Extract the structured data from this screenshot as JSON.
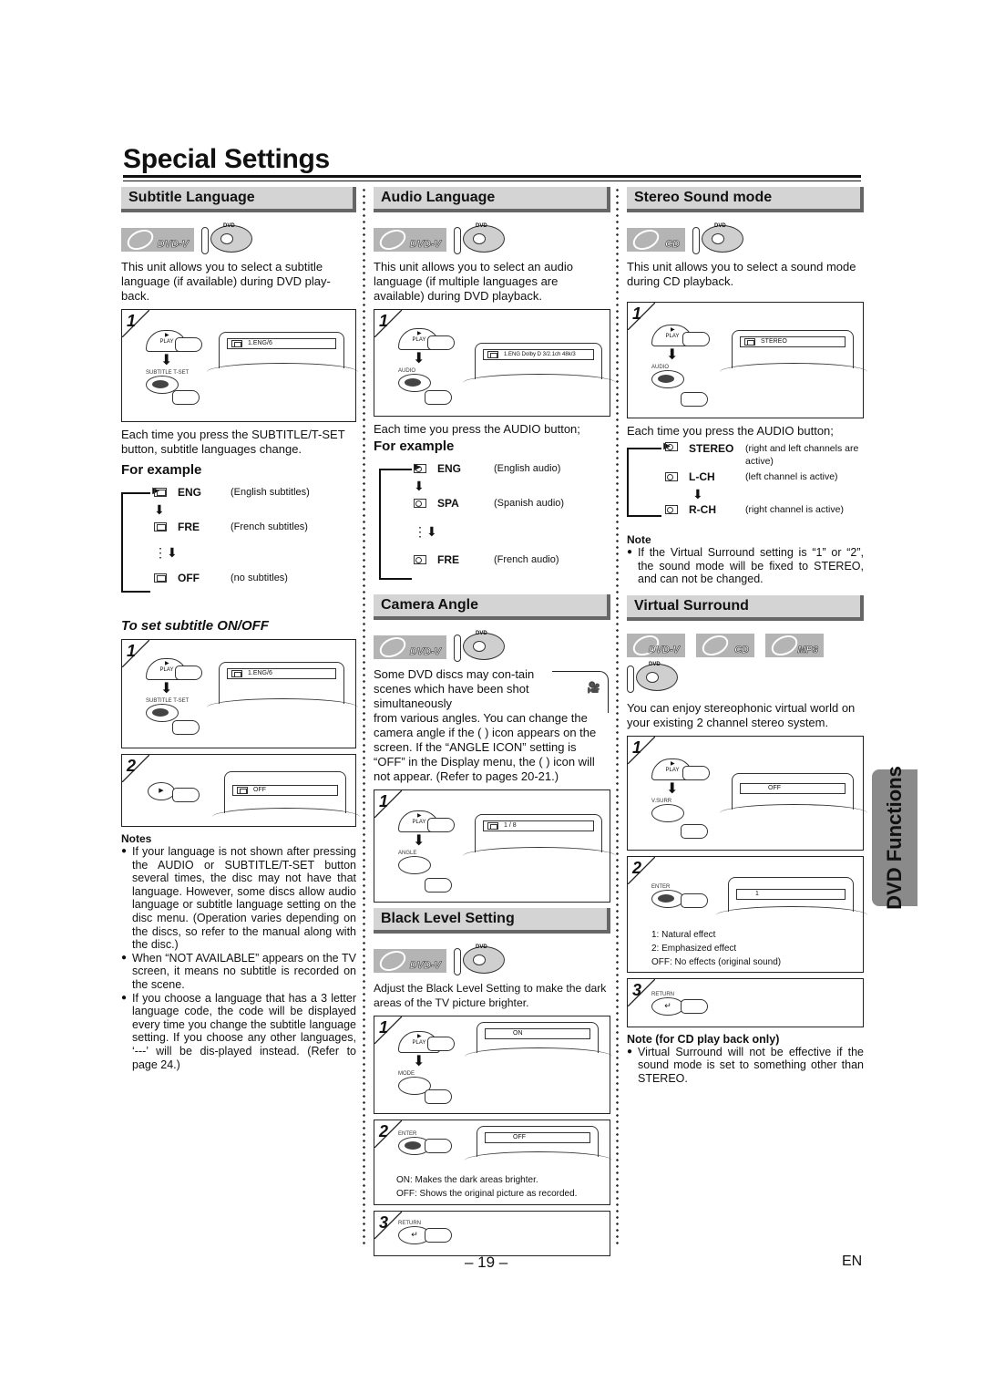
{
  "page": {
    "title": "Special Settings",
    "page_number": "– 19 –",
    "language_code": "EN",
    "side_tab": "DVD Functions"
  },
  "subtitle_language": {
    "heading": "Subtitle Language",
    "badges": [
      "DVD-V",
      "DVD"
    ],
    "intro": "This unit allows you to select a subtitle language (if available) during DVD play-back.",
    "step1": {
      "number": "1",
      "play_label": "PLAY",
      "button_label": "SUBTITLE T-SET",
      "osd": "1.ENG/6"
    },
    "after_step": "Each time you press the SUBTITLE/T-SET button, subtitle languages change.",
    "example_heading": "For example",
    "cycle": [
      {
        "code": "ENG",
        "desc": "(English subtitles)"
      },
      {
        "code": "FRE",
        "desc": "(French subtitles)"
      },
      {
        "code": "OFF",
        "desc": "(no subtitles)"
      }
    ],
    "onoff_heading": "To set subtitle ON/OFF",
    "onoff_step1": {
      "number": "1",
      "play_label": "PLAY",
      "button_label": "SUBTITLE T-SET",
      "osd": "1.ENG/6"
    },
    "onoff_step2": {
      "number": "2",
      "osd": "OFF"
    },
    "notes_heading": "Notes",
    "notes": [
      "If your language is not shown after pressing the AUDIO or SUBTITLE/T-SET button several times, the disc may not have that language. However, some discs allow audio language or subtitle language setting on the disc menu. (Operation varies depending on the discs, so refer to the manual along with the disc.)",
      "When “NOT AVAILABLE” appears on the TV screen, it means no subtitle is recorded on the scene.",
      "If you choose a language that has a 3 letter language code, the code will be displayed every time you change the subtitle language setting. If you choose any other languages, ‘---’ will be dis-played instead. (Refer to page 24.)"
    ]
  },
  "audio_language": {
    "heading": "Audio Language",
    "badges": [
      "DVD-V",
      "DVD"
    ],
    "intro": "This unit allows you to select an audio language (if multiple languages are available) during DVD playback.",
    "step1": {
      "number": "1",
      "play_label": "PLAY",
      "button_label": "AUDIO",
      "osd": "1.ENG  Dolby D  3/2.1ch  48k/3"
    },
    "after_step": "Each time you press the AUDIO button;",
    "example_heading": "For example",
    "cycle": [
      {
        "code": "ENG",
        "desc": "(English audio)"
      },
      {
        "code": "SPA",
        "desc": "(Spanish audio)"
      },
      {
        "code": "FRE",
        "desc": "(French audio)"
      }
    ]
  },
  "camera_angle": {
    "heading": "Camera Angle",
    "badges": [
      "DVD-V",
      "DVD"
    ],
    "intro_part1": "Some DVD discs may con-tain scenes which have been shot simultaneously",
    "intro_part2": "from various angles. You can change the camera angle if the ( ) icon appears on the screen. If the “ANGLE ICON” setting is “OFF” in the Display menu, the ( ) icon will not appear. (Refer to pages 20-21.)",
    "step1": {
      "number": "1",
      "play_label": "PLAY",
      "button_label": "ANGLE",
      "osd": "1 / 8"
    }
  },
  "black_level": {
    "heading": "Black Level Setting",
    "badges": [
      "DVD-V",
      "DVD"
    ],
    "intro": "Adjust the Black Level Setting to make the dark areas of the TV picture brighter.",
    "step1": {
      "number": "1",
      "play_label": "PLAY",
      "button_label": "MODE",
      "osd": "ON"
    },
    "step2": {
      "number": "2",
      "button_label": "ENTER",
      "osd": "OFF",
      "lines": [
        "ON: Makes the dark areas brighter.",
        "OFF: Shows the original picture as recorded."
      ]
    },
    "step3": {
      "number": "3",
      "button_label": "RETURN"
    }
  },
  "stereo_sound": {
    "heading": "Stereo Sound mode",
    "badges": [
      "CD",
      "DVD"
    ],
    "intro": "This unit allows you to select a sound mode during CD playback.",
    "step1": {
      "number": "1",
      "play_label": "PLAY",
      "button_label": "AUDIO",
      "osd": "STEREO"
    },
    "after_step": "Each time you press the AUDIO button;",
    "cycle": [
      {
        "code": "STEREO",
        "desc": "(right and left channels are active)"
      },
      {
        "code": "L-CH",
        "desc": "(left channel is active)"
      },
      {
        "code": "R-CH",
        "desc": "(right channel is active)"
      }
    ],
    "note_heading": "Note",
    "note": "If the Virtual Surround setting is “1” or “2”, the sound mode will be fixed to STEREO, and can not be changed."
  },
  "virtual_surround": {
    "heading": "Virtual Surround",
    "badges": [
      "DVD-V",
      "CD",
      "MP3",
      "DVD"
    ],
    "intro": "You can enjoy stereophonic virtual world on your existing 2 channel stereo system.",
    "step1": {
      "number": "1",
      "play_label": "PLAY",
      "button_label": "V.SURR",
      "osd": "OFF"
    },
    "step2": {
      "number": "2",
      "button_label": "ENTER",
      "osd": "1",
      "lines": [
        "1: Natural effect",
        "2: Emphasized effect",
        "OFF: No effects (original sound)"
      ]
    },
    "step3": {
      "number": "3",
      "button_label": "RETURN"
    },
    "note_heading": "Note (for CD play back only)",
    "note": "Virtual Surround will not be effective if the sound mode is set to something other than STEREO."
  }
}
